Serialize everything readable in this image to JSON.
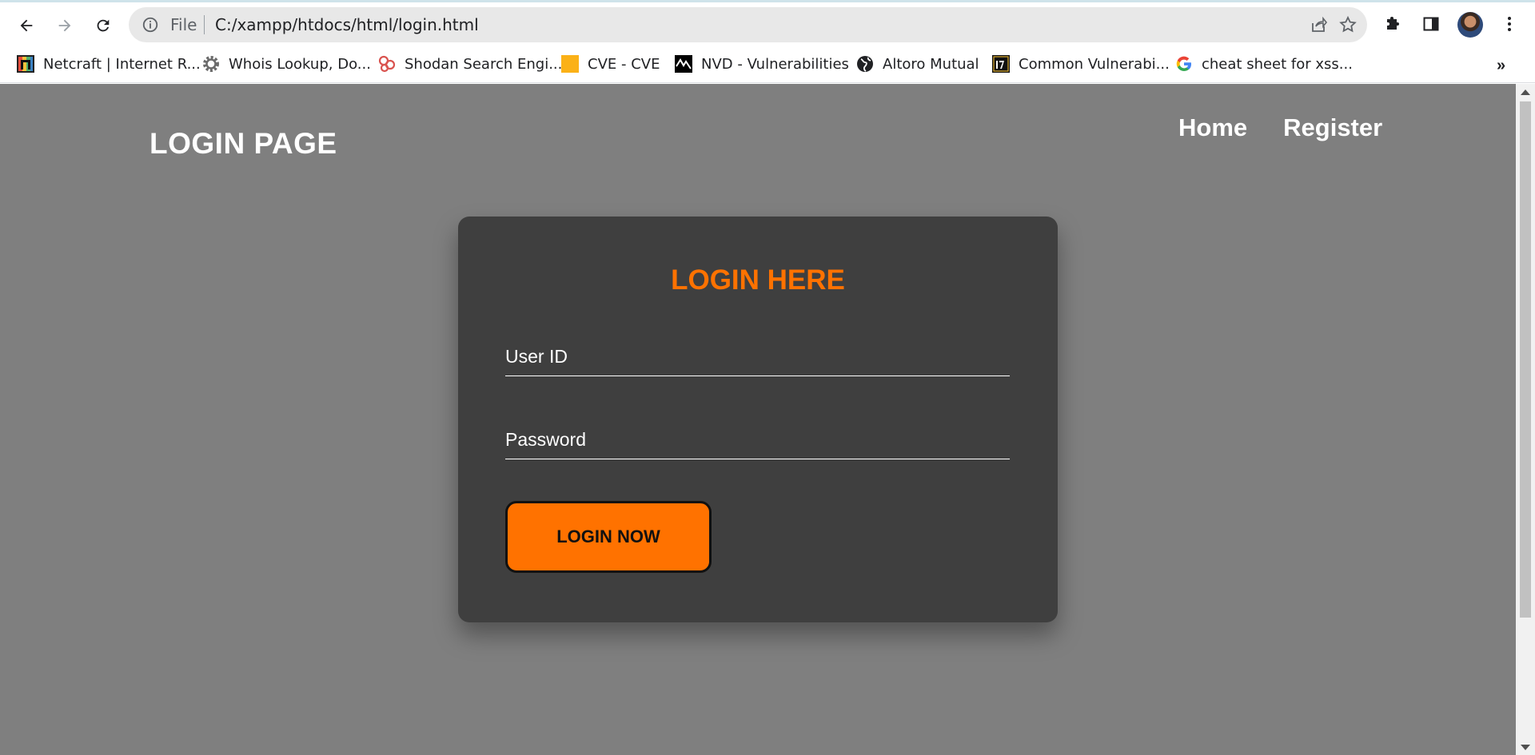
{
  "browser": {
    "address_prefix": "File",
    "url": "C:/xampp/htdocs/html/login.html",
    "bookmarks": [
      {
        "label": "Netcraft | Internet R...",
        "icon": "netcraft-icon"
      },
      {
        "label": "Whois Lookup, Do...",
        "icon": "gear-icon"
      },
      {
        "label": "Shodan Search Engi...",
        "icon": "shodan-icon"
      },
      {
        "label": "CVE - CVE",
        "icon": "cve-icon"
      },
      {
        "label": "NVD - Vulnerabilities",
        "icon": "nvd-icon"
      },
      {
        "label": "Altoro Mutual",
        "icon": "globe-icon"
      },
      {
        "label": "Common Vulnerabi...",
        "icon": "cwe-icon"
      },
      {
        "label": "cheat sheet for xss...",
        "icon": "google-icon"
      }
    ],
    "more_bookmarks": "»"
  },
  "page": {
    "brand": "LOGIN PAGE",
    "nav": [
      {
        "label": "Home"
      },
      {
        "label": "Register"
      }
    ],
    "form": {
      "title": "LOGIN HERE",
      "user_placeholder": "User ID",
      "password_placeholder": "Password",
      "submit_label": "LOGIN NOW"
    }
  },
  "colors": {
    "page_background": "#7f7f7f",
    "card_background": "#3f3f3f",
    "accent": "#ff7200",
    "text": "#ffffff"
  }
}
